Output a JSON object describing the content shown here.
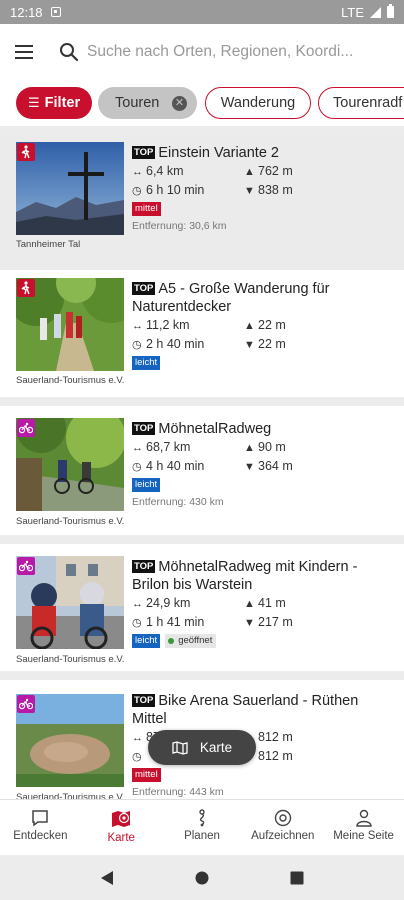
{
  "status_bar": {
    "time": "12:18",
    "network": "LTE"
  },
  "search": {
    "placeholder": "Suche nach Orten, Regionen, Koordi..."
  },
  "chips": {
    "filter_label": "Filter",
    "touren_label": "Touren",
    "wanderung_label": "Wanderung",
    "routen_label": "Tourenradf"
  },
  "colors": {
    "accent": "#c8102e",
    "hike_icon_bg": "#c8102e",
    "bike_icon_bg": "#b81aa8",
    "leicht": "#1565c0",
    "mittel": "#c8102e"
  },
  "cards": [
    {
      "top": "TOP",
      "title": "Einstein Variante 2",
      "distance": "6,4 km",
      "ascent": "762 m",
      "duration": "6 h 10 min",
      "descent": "838 m",
      "difficulty": "mittel",
      "entfernung": "Entfernung: 30,6 km",
      "source": "Tannheimer Tal",
      "activity_icon": "hiking-icon"
    },
    {
      "top": "TOP",
      "title": "A5 - Große Wanderung für Naturentdecker",
      "distance": "11,2 km",
      "ascent": "22 m",
      "duration": "2 h 40 min",
      "descent": "22 m",
      "difficulty": "leicht",
      "entfernung": "",
      "source": "Sauerland-Tourismus e.V.",
      "activity_icon": "hiking-icon"
    },
    {
      "top": "TOP",
      "title": "MöhnetalRadweg",
      "distance": "68,7 km",
      "ascent": "90 m",
      "duration": "4 h 40 min",
      "descent": "364 m",
      "difficulty": "leicht",
      "entfernung": "Entfernung: 430 km",
      "source": "Sauerland-Tourismus e.V.",
      "activity_icon": "bicycle-icon"
    },
    {
      "top": "TOP",
      "title": "MöhnetalRadweg mit Kindern - Brilon bis Warstein",
      "distance": "24,9 km",
      "ascent": "41 m",
      "duration": "1 h 41 min",
      "descent": "217 m",
      "difficulty": "leicht",
      "status": "geöffnet",
      "entfernung": "",
      "source": "Sauerland-Tourismus e.V.",
      "activity_icon": "bicycle-icon"
    },
    {
      "top": "TOP",
      "title": "Bike Arena Sauerland - Rüthen Mittel",
      "distance": "87,2 km",
      "ascent": "812 m",
      "duration": "",
      "descent": "812 m",
      "difficulty": "mittel",
      "entfernung": "Entfernung: 443 km",
      "source": "Sauerland-Tourismus e.V.",
      "activity_icon": "bicycle-icon"
    }
  ],
  "map_button": {
    "label": "Karte"
  },
  "bottom_nav": [
    {
      "label": "Entdecken",
      "icon": "chat-bubble-icon"
    },
    {
      "label": "Karte",
      "icon": "map-pin-icon",
      "active": true
    },
    {
      "label": "Planen",
      "icon": "route-icon"
    },
    {
      "label": "Aufzeichnen",
      "icon": "record-icon"
    },
    {
      "label": "Meine Seite",
      "icon": "user-icon"
    }
  ]
}
